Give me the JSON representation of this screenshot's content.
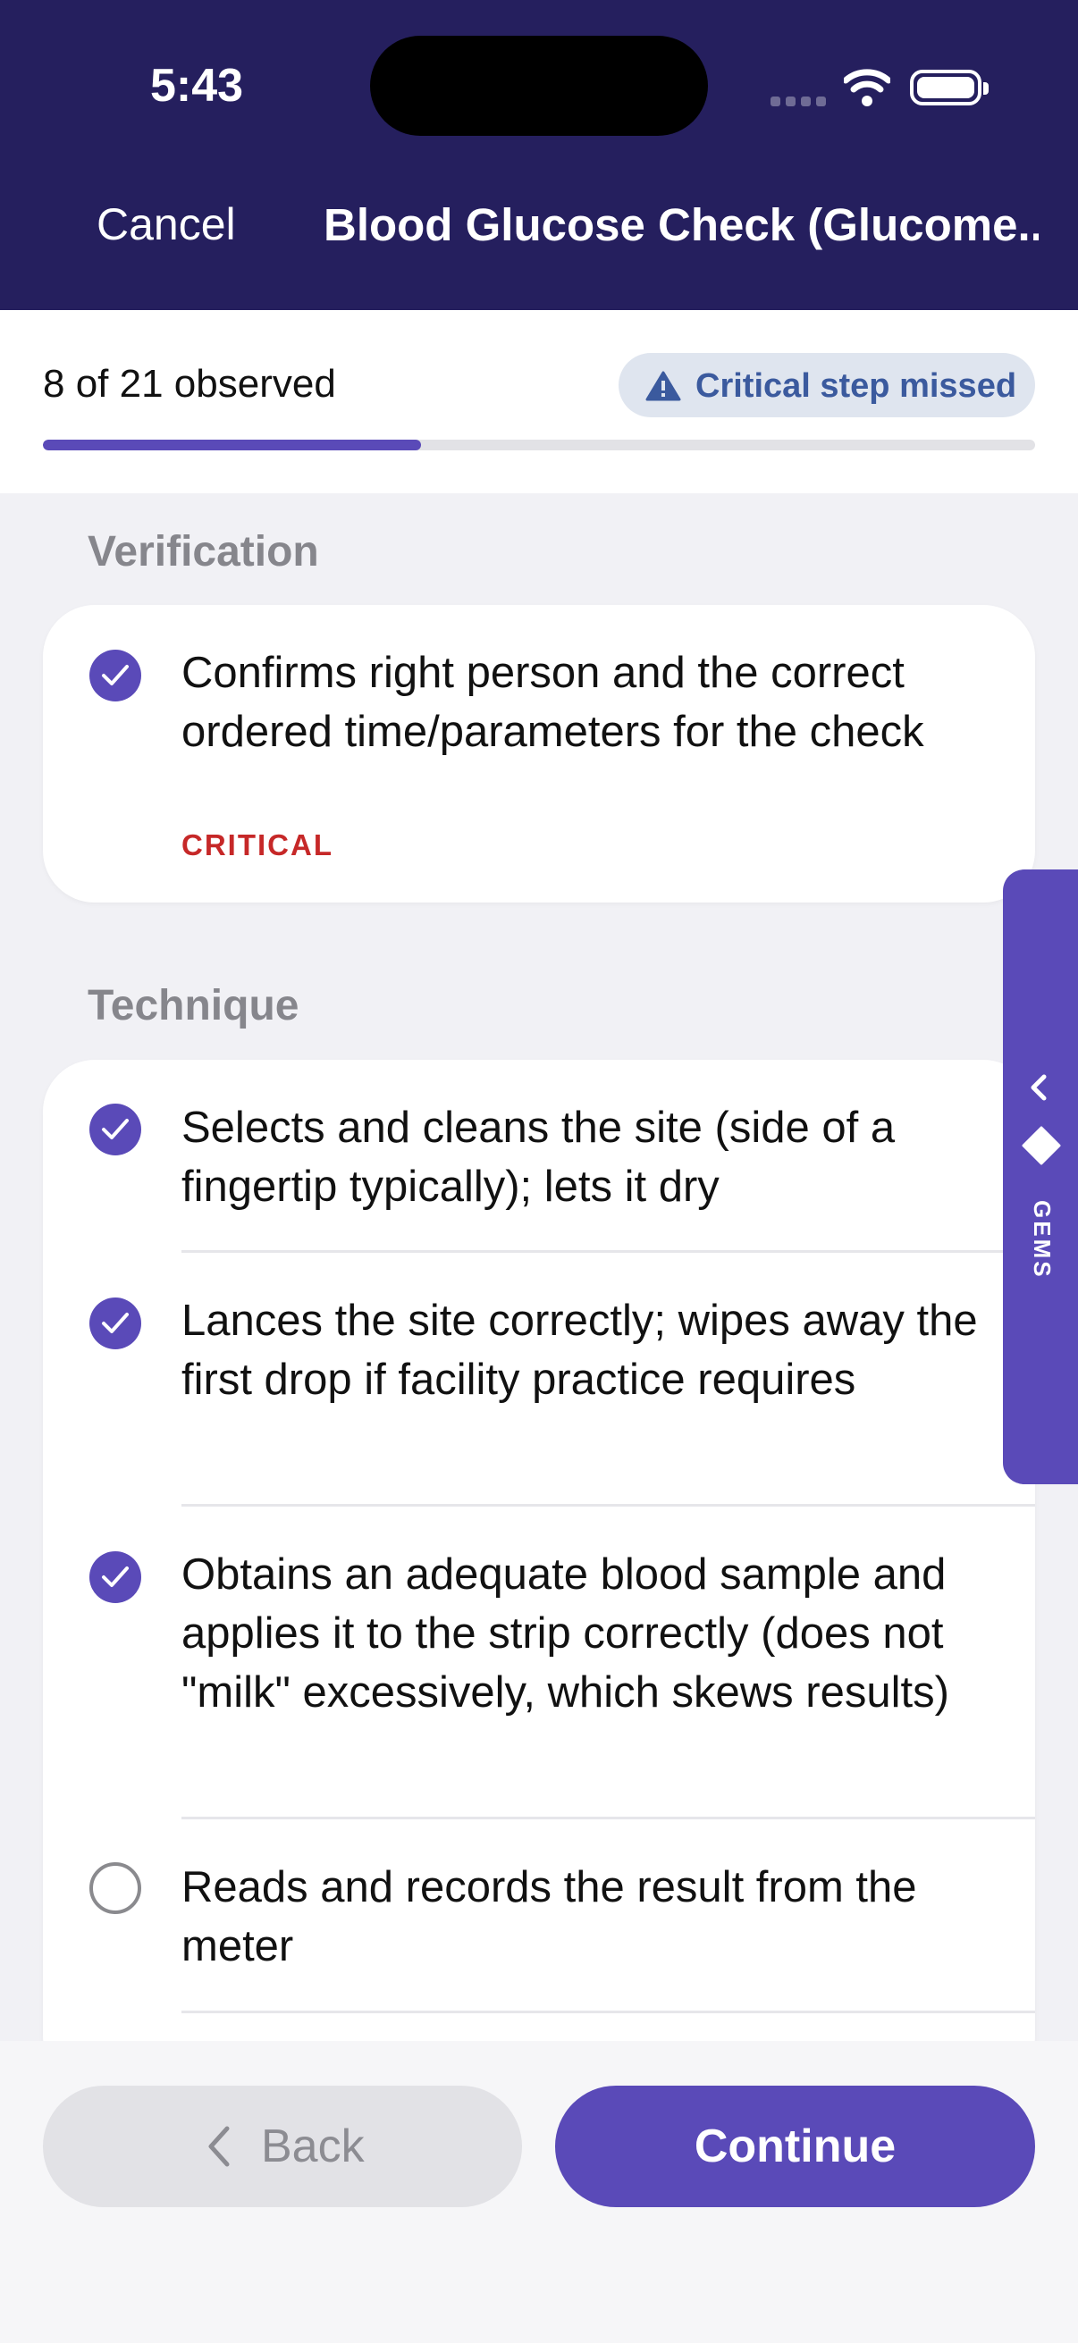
{
  "status_bar": {
    "time": "5:43"
  },
  "nav": {
    "cancel_label": "Cancel",
    "title": "Blood Glucose Check (Glucome..."
  },
  "progress": {
    "observed_text": "8 of 21 observed",
    "fraction": 0.381,
    "badge_text": "Critical step missed"
  },
  "sections": [
    {
      "title": "Verification",
      "items": [
        {
          "text": "Confirms right person and the correct ordered time/parameters for the check",
          "checked": true,
          "tag": "CRITICAL"
        }
      ]
    },
    {
      "title": "Technique",
      "items": [
        {
          "text": "Selects and cleans the site (side of a fingertip typically); lets it dry",
          "checked": true
        },
        {
          "text": "Lances the site correctly; wipes away the first drop if facility practice requires",
          "checked": true
        },
        {
          "text": "Obtains an adequate blood sample and applies it to the strip correctly (does not \"milk\" excessively, which skews results)",
          "checked": true
        },
        {
          "text": "Reads and records the result from the meter",
          "checked": false
        }
      ]
    }
  ],
  "side_tab": {
    "label": "GEMS"
  },
  "footer": {
    "back_label": "Back",
    "continue_label": "Continue"
  },
  "colors": {
    "header_bg": "#251f5e",
    "accent": "#5a4ab8",
    "critical": "#c62828",
    "badge_text": "#3b5a9e"
  }
}
